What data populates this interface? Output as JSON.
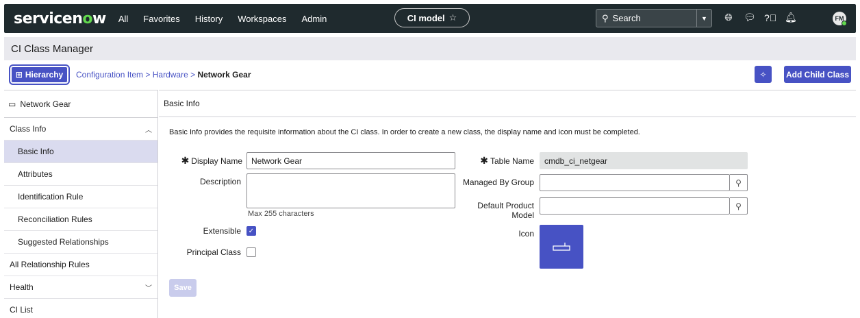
{
  "brand": {
    "logo_prefix": "servicen",
    "logo_o": "o",
    "logo_suffix": "w"
  },
  "nav": {
    "links": [
      "All",
      "Favorites",
      "History",
      "Workspaces",
      "Admin"
    ],
    "pill_label": "CI model",
    "search_placeholder": "Search",
    "avatar_initials": "FM"
  },
  "page_title": "CI Class Manager",
  "toolbar": {
    "hierarchy_label": "Hierarchy",
    "crumb_1": "Configuration Item",
    "crumb_sep": " > ",
    "crumb_2": "Hardware",
    "crumb_current": "Network Gear",
    "add_child_label": "Add Child Class"
  },
  "sidebar": {
    "header": "Network Gear",
    "items": [
      {
        "label": "Class Info",
        "type": "top",
        "chevron": "up"
      },
      {
        "label": "Basic Info",
        "type": "sub",
        "active": true
      },
      {
        "label": "Attributes",
        "type": "sub"
      },
      {
        "label": "Identification Rule",
        "type": "sub"
      },
      {
        "label": "Reconciliation Rules",
        "type": "sub"
      },
      {
        "label": "Suggested Relationships",
        "type": "sub"
      },
      {
        "label": "All Relationship Rules",
        "type": "top"
      },
      {
        "label": "Health",
        "type": "top",
        "chevron": "down"
      },
      {
        "label": "CI List",
        "type": "top"
      }
    ]
  },
  "main": {
    "section_title": "Basic Info",
    "description": "Basic Info provides the requisite information about the CI class. In order to create a new class, the display name and icon must be completed.",
    "form": {
      "display_name_label": "Display Name",
      "display_name_value": "Network Gear",
      "description_label": "Description",
      "description_value": "",
      "description_hint": "Max 255 characters",
      "extensible_label": "Extensible",
      "extensible_checked": true,
      "principal_label": "Principal Class",
      "principal_checked": false,
      "table_name_label": "Table Name",
      "table_name_value": "cmdb_ci_netgear",
      "managed_by_label": "Managed By Group",
      "managed_by_value": "",
      "default_product_label_1": "Default Product",
      "default_product_label_2": "Model",
      "default_product_value": "",
      "icon_label": "Icon",
      "save_label": "Save"
    }
  },
  "colors": {
    "accent": "#4752c4",
    "navbar": "#1f2a2e",
    "active_bg": "#dadbef",
    "brand_green": "#62d84e"
  }
}
